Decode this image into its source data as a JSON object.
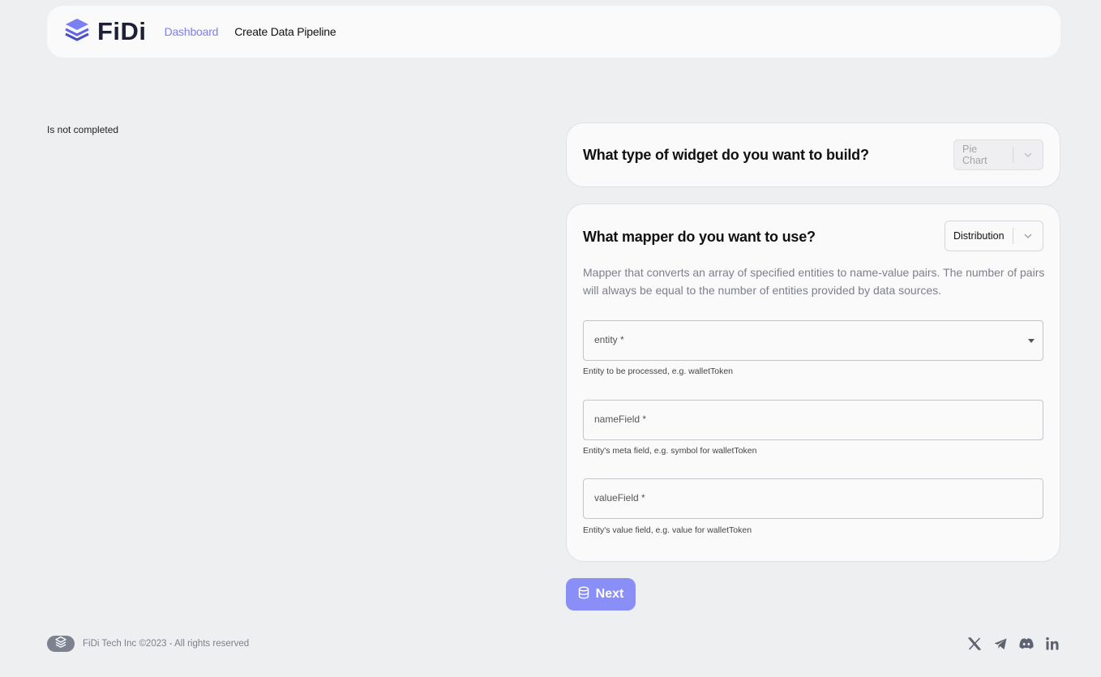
{
  "header": {
    "brand": "FiDi",
    "nav": [
      {
        "label": "Dashboard"
      },
      {
        "label": "Create Data Pipeline"
      }
    ]
  },
  "status": "Is not completed",
  "widget_card": {
    "title": "What type of widget do you want to build?",
    "select_value": "Pie Chart"
  },
  "mapper_card": {
    "title": "What mapper do you want to use?",
    "select_value": "Distribution",
    "description": "Mapper that converts an array of specified entities to name-value pairs. The number of pairs will always be equal to the number of entities provided by data sources.",
    "fields": [
      {
        "label": "entity *",
        "helper": "Entity to be processed, e.g. walletToken"
      },
      {
        "label": "nameField *",
        "helper": "Entity's meta field, e.g. symbol for walletToken"
      },
      {
        "label": "valueField *",
        "helper": "Entity's value field, e.g. value for walletToken"
      }
    ]
  },
  "next_button": "Next",
  "footer": {
    "copyright": "FiDi Tech Inc ©2023 - All rights reserved",
    "socials": [
      "x-icon",
      "telegram-icon",
      "discord-icon",
      "linkedin-icon"
    ]
  },
  "colors": {
    "accent": "#7b7ff4",
    "button": "#8a8ef7",
    "background": "#eeeff1"
  }
}
